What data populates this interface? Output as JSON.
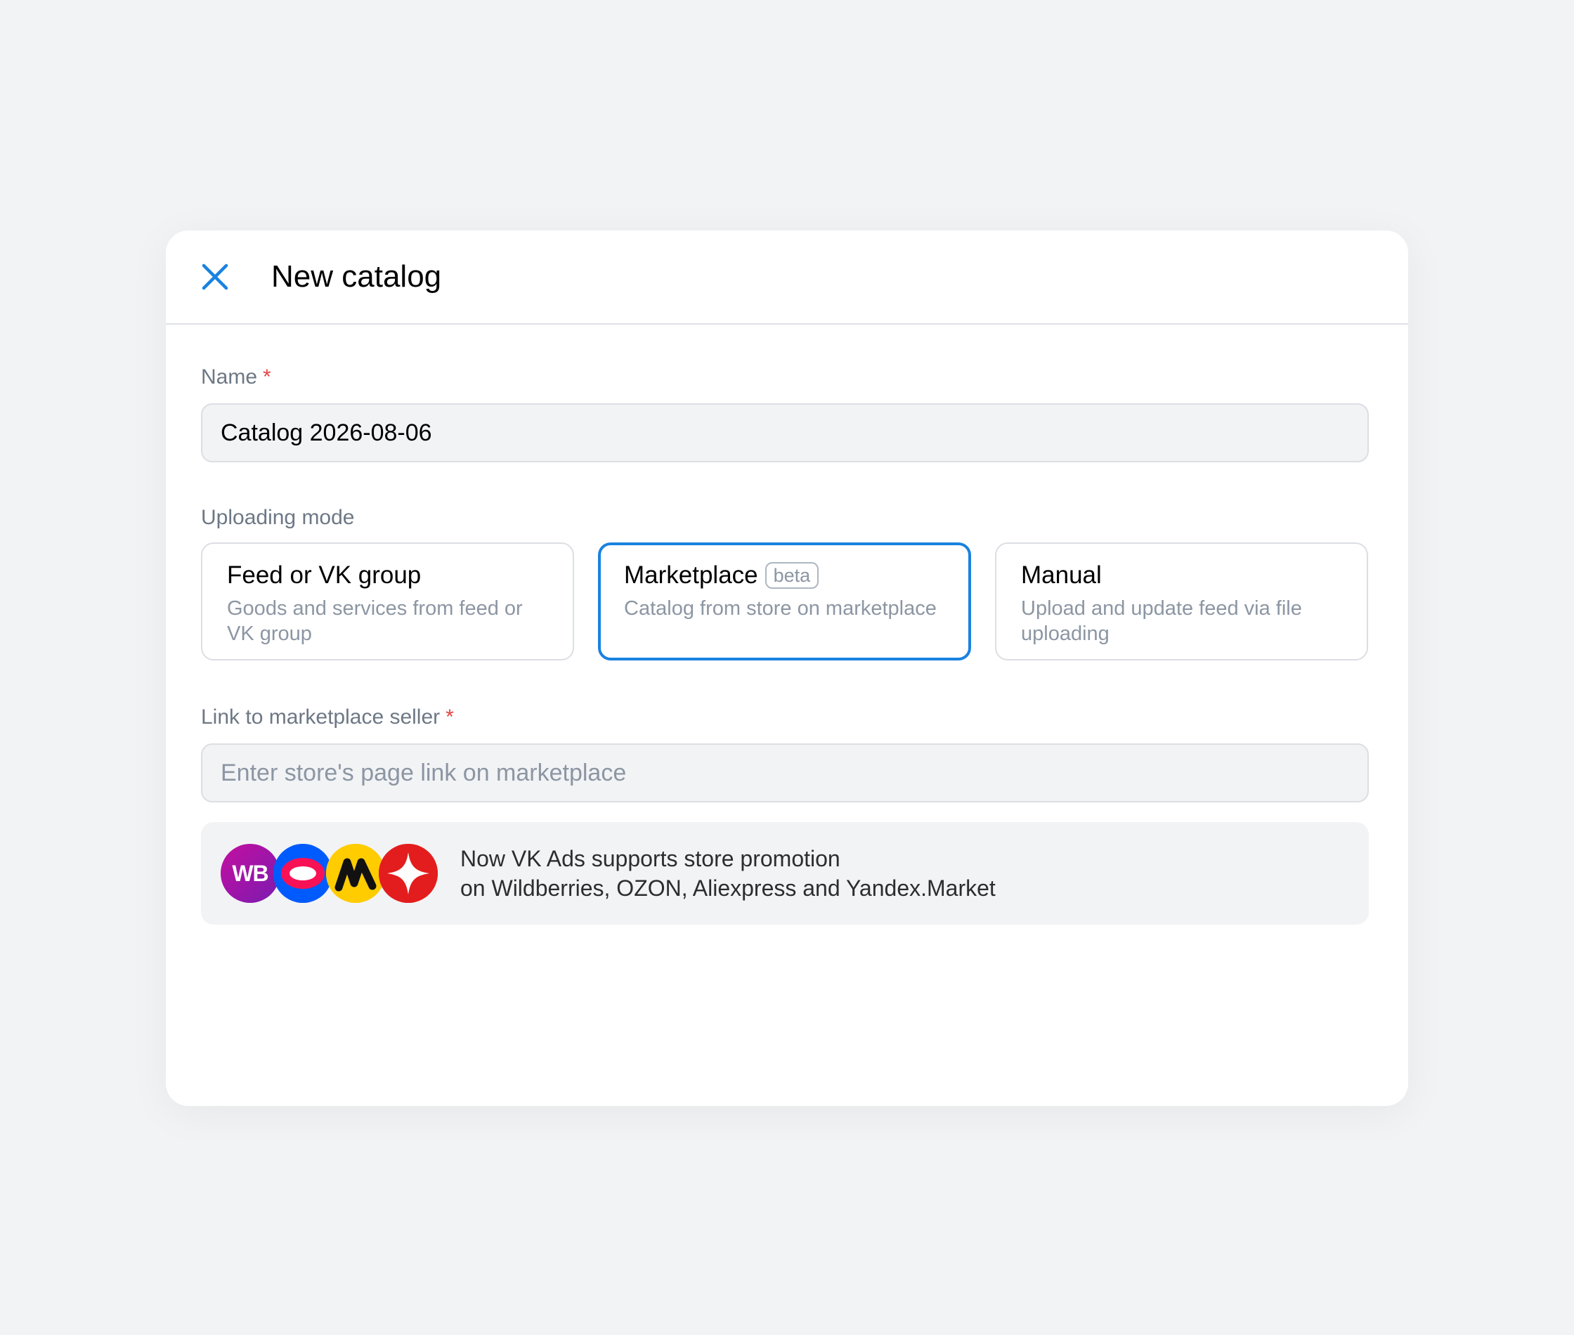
{
  "modal": {
    "title": "New catalog",
    "close_icon": "close-icon"
  },
  "name_field": {
    "label": "Name",
    "required_mark": "*",
    "value": "Catalog 2026-08-06"
  },
  "uploading_mode": {
    "label": "Uploading mode",
    "options": [
      {
        "title": "Feed or VK group",
        "description": "Goods and services from feed or VK group",
        "selected": false
      },
      {
        "title": "Marketplace",
        "badge": "beta",
        "description": "Catalog from store on marketplace",
        "selected": true
      },
      {
        "title": "Manual",
        "description": "Upload and update feed via file uploading",
        "selected": false
      }
    ]
  },
  "link_field": {
    "label": "Link to marketplace seller",
    "required_mark": "*",
    "value": "",
    "placeholder": "Enter store's page link on marketplace"
  },
  "banner": {
    "logos": [
      {
        "name": "wildberries-logo",
        "text": "WB"
      },
      {
        "name": "ozon-logo"
      },
      {
        "name": "yandex-market-logo"
      },
      {
        "name": "aliexpress-logo"
      }
    ],
    "line1": "Now VK Ads supports store promotion",
    "line2": "on Wildberries, OZON, Aliexpress and Yandex.Market"
  },
  "colors": {
    "accent": "#1a82e0",
    "required": "#e64646",
    "background": "#f2f3f5"
  }
}
